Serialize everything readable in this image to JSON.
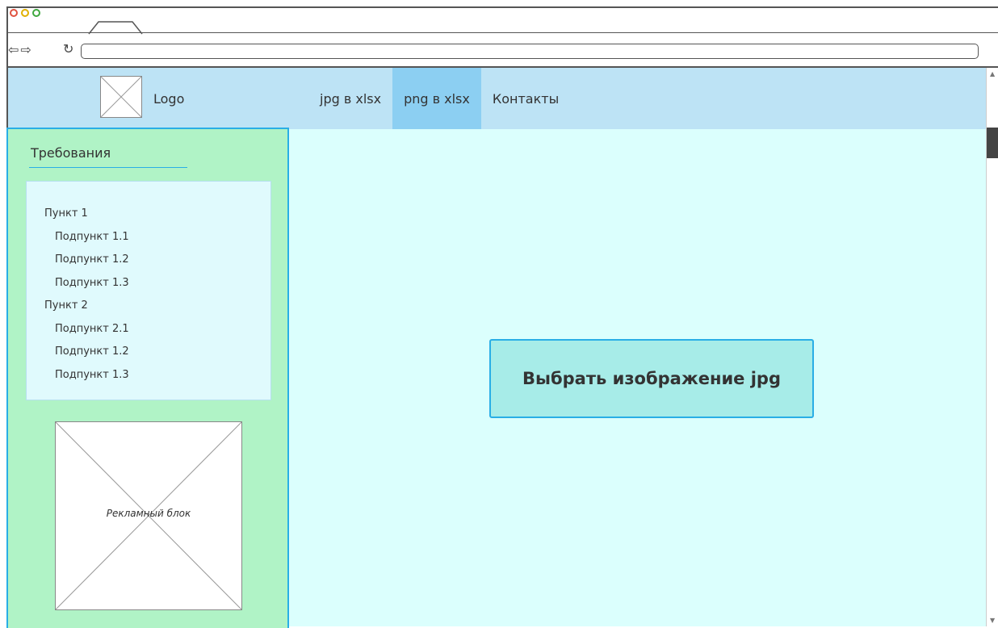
{
  "header": {
    "logo_text": "Logo",
    "nav": [
      {
        "label": "jpg в xlsx",
        "active": false
      },
      {
        "label": "png в xlsx",
        "active": true
      },
      {
        "label": "Контакты",
        "active": false
      }
    ]
  },
  "sidebar": {
    "title": "Требования",
    "requirements": [
      {
        "label": "Пункт 1",
        "level": 0
      },
      {
        "label": "Подпункт 1.1",
        "level": 1
      },
      {
        "label": "Подпункт 1.2",
        "level": 1
      },
      {
        "label": "Подпункт 1.3",
        "level": 1
      },
      {
        "label": "Пункт 2",
        "level": 0
      },
      {
        "label": "Подпункт 2.1",
        "level": 1
      },
      {
        "label": "Подпункт 1.2",
        "level": 1
      },
      {
        "label": "Подпункт 1.3",
        "level": 1
      }
    ],
    "ad_label": "Рекламный блок"
  },
  "main": {
    "select_button_label": "Выбрать изображение jpg"
  },
  "colors": {
    "header_bg": "#bde3f5",
    "nav_active_bg": "#8ccff2",
    "sidebar_bg": "#b0f3c6",
    "sidebar_border": "#29aee6",
    "main_bg": "#dbfffd",
    "button_bg": "#a7ece8"
  }
}
